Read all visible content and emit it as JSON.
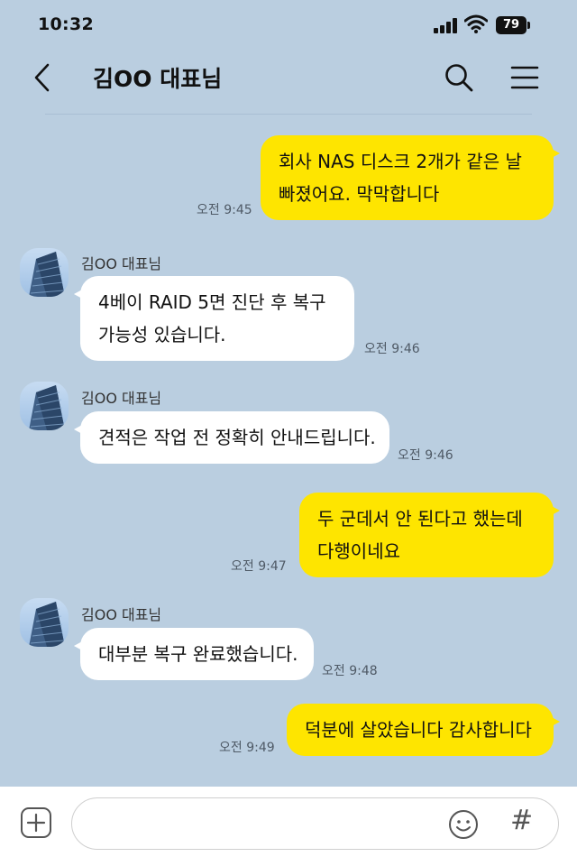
{
  "status_bar": {
    "time": "10:32",
    "battery": "79"
  },
  "header": {
    "title": "김OO 대표님"
  },
  "messages": [
    {
      "side": "me",
      "lines": [
        "회사 NAS 디스크 2개가 같은 날",
        "빠졌어요. 막막합니다"
      ],
      "time": "오전 9:45"
    },
    {
      "side": "them",
      "sender": "김OO 대표님",
      "lines": [
        "4베이 RAID 5면 진단 후 복구",
        "가능성 있습니다."
      ],
      "time": "오전 9:46"
    },
    {
      "side": "them",
      "sender": "김OO 대표님",
      "lines": [
        "견적은 작업 전 정확히 안내드립니다."
      ],
      "time": "오전 9:46"
    },
    {
      "side": "me",
      "lines": [
        "두 군데서 안 된다고 했는데",
        "다행이네요"
      ],
      "time": "오전 9:47"
    },
    {
      "side": "them",
      "sender": "김OO 대표님",
      "lines": [
        "대부분 복구 완료했습니다."
      ],
      "time": "오전 9:48"
    },
    {
      "side": "me",
      "lines": [
        "덕분에 살았습니다 감사합니다"
      ],
      "time": "오전 9:49"
    }
  ],
  "input": {
    "placeholder": ""
  },
  "icons": {
    "back": "chevron-left-icon",
    "search": "search-icon",
    "menu": "hamburger-menu-icon",
    "add": "plus-square-icon",
    "emoji": "smiley-icon",
    "hash": "hash-icon"
  },
  "colors": {
    "background": "#bacee0",
    "my_bubble": "#fee500",
    "their_bubble": "#ffffff"
  }
}
